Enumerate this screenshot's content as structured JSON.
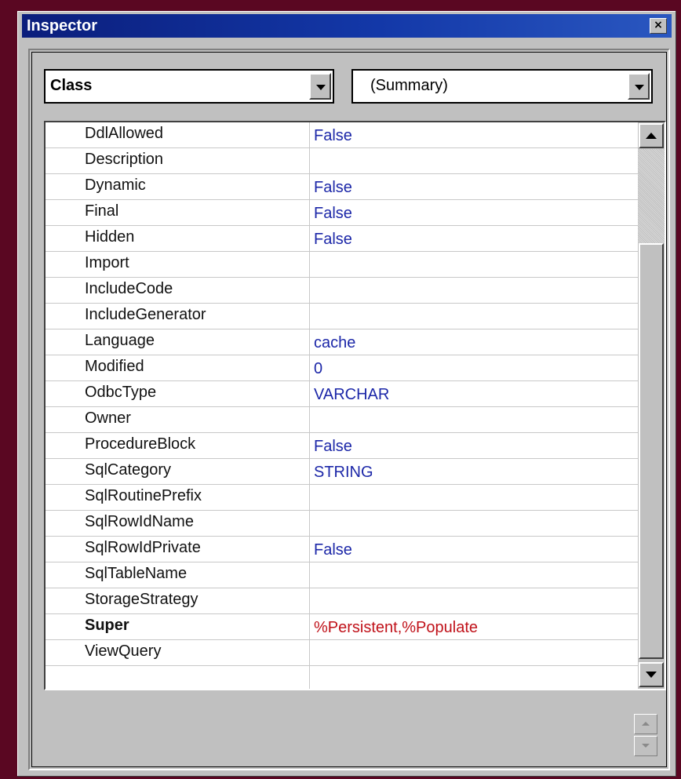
{
  "window": {
    "title": "Inspector",
    "close_glyph": "×"
  },
  "selectors": {
    "category": {
      "selected": "Class"
    },
    "view": {
      "selected": "(Summary)"
    }
  },
  "properties": [
    {
      "name": "DdlAllowed",
      "value": "False"
    },
    {
      "name": "Description",
      "value": ""
    },
    {
      "name": "Dynamic",
      "value": "False"
    },
    {
      "name": "Final",
      "value": "False"
    },
    {
      "name": "Hidden",
      "value": "False"
    },
    {
      "name": "Import",
      "value": ""
    },
    {
      "name": "IncludeCode",
      "value": ""
    },
    {
      "name": "IncludeGenerator",
      "value": ""
    },
    {
      "name": "Language",
      "value": "cache"
    },
    {
      "name": "Modified",
      "value": "0"
    },
    {
      "name": "OdbcType",
      "value": "VARCHAR"
    },
    {
      "name": "Owner",
      "value": ""
    },
    {
      "name": "ProcedureBlock",
      "value": "False"
    },
    {
      "name": "SqlCategory",
      "value": "STRING"
    },
    {
      "name": "SqlRoutinePrefix",
      "value": ""
    },
    {
      "name": "SqlRowIdName",
      "value": ""
    },
    {
      "name": "SqlRowIdPrivate",
      "value": "False"
    },
    {
      "name": "SqlTableName",
      "value": ""
    },
    {
      "name": "StorageStrategy",
      "value": ""
    },
    {
      "name": "Super",
      "value": "%Persistent,%Populate"
    },
    {
      "name": "ViewQuery",
      "value": ""
    },
    {
      "name": "",
      "value": ""
    }
  ],
  "colors": {
    "desktop": "#5a0722",
    "titlebar": "#0b1e7c",
    "value_text": "#1c27a8",
    "modified_value_text": "#c0121a"
  },
  "icons": {
    "close": "close-icon",
    "dropdown": "chevron-down-icon",
    "scroll_up": "arrow-up-icon",
    "scroll_down": "arrow-down-icon"
  }
}
